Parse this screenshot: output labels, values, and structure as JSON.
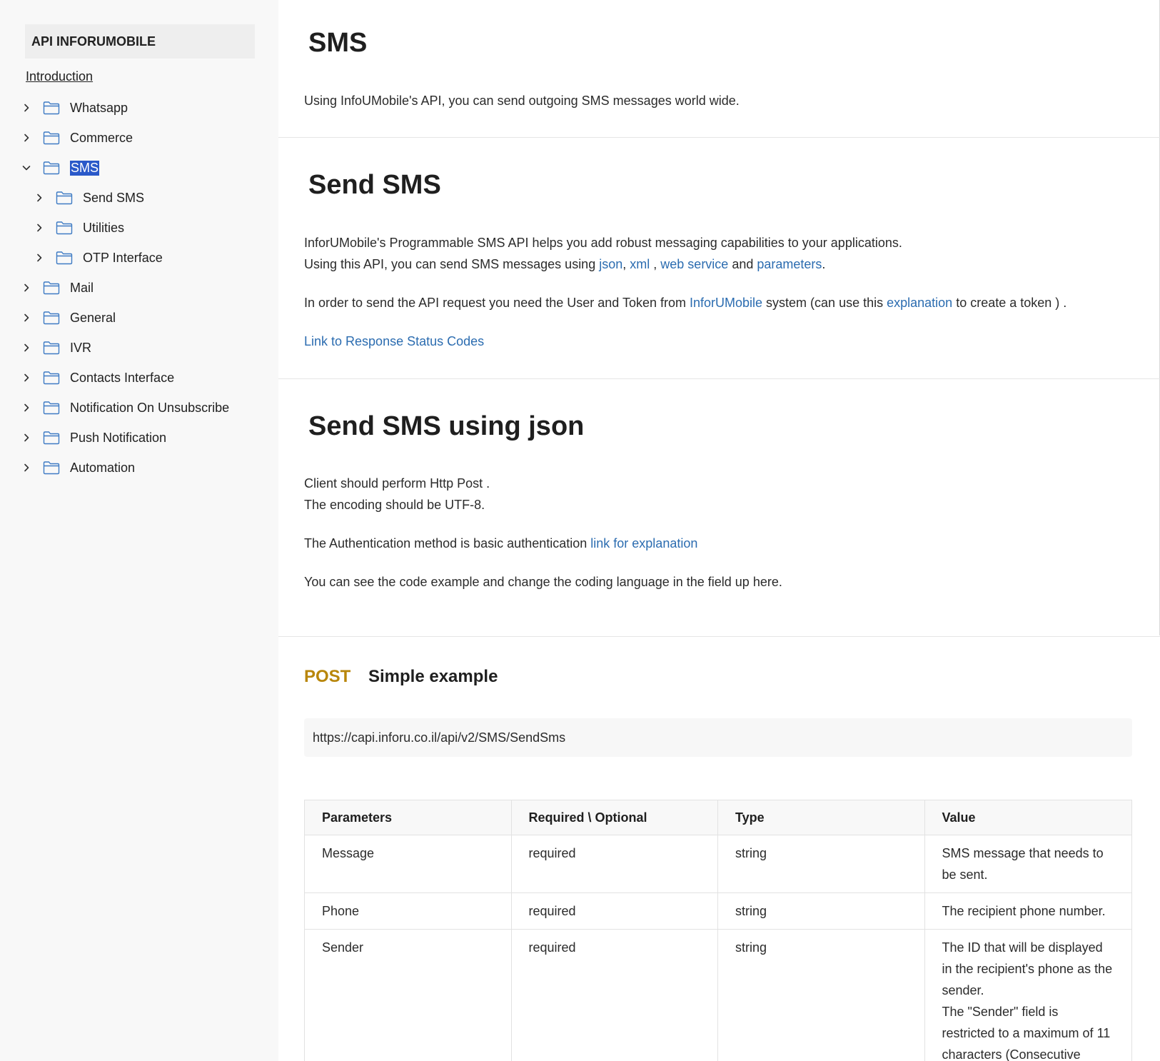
{
  "sidebar": {
    "brand": "API INFORUMOBILE",
    "intro": "Introduction",
    "items": [
      {
        "label": "Whatsapp",
        "level": 1,
        "expanded": false
      },
      {
        "label": "Commerce",
        "level": 1,
        "expanded": false
      },
      {
        "label": "SMS",
        "level": 1,
        "expanded": true,
        "selected": true
      },
      {
        "label": "Send SMS",
        "level": 2,
        "expanded": false
      },
      {
        "label": "Utilities",
        "level": 2,
        "expanded": false
      },
      {
        "label": "OTP Interface",
        "level": 2,
        "expanded": false
      },
      {
        "label": "Mail",
        "level": 1,
        "expanded": false
      },
      {
        "label": "General",
        "level": 1,
        "expanded": false
      },
      {
        "label": "IVR",
        "level": 1,
        "expanded": false
      },
      {
        "label": "Contacts Interface",
        "level": 1,
        "expanded": false
      },
      {
        "label": "Notification On Unsubscribe",
        "level": 1,
        "expanded": false
      },
      {
        "label": "Push Notification",
        "level": 1,
        "expanded": false
      },
      {
        "label": "Automation",
        "level": 1,
        "expanded": false
      }
    ]
  },
  "sms": {
    "title": "SMS",
    "desc": "Using InfoUMobile's API, you can send outgoing SMS messages world wide."
  },
  "send_sms": {
    "title": "Send SMS",
    "line1": "InforUMobile's Programmable SMS API helps you add robust messaging capabilities to your applications.",
    "line2_prefix": "Using this API, you can send SMS messages using ",
    "link_json": "json",
    "comma1": ", ",
    "link_xml": "xml",
    "comma2": " , ",
    "link_ws": "web service",
    "and": " and ",
    "link_params": "parameters",
    "dot": ".",
    "line3_prefix": "In order to send the API request you need the User and Token from ",
    "link_inforu": "InforUMobile",
    "line3_mid": " system (can use this ",
    "link_expl": "explanation",
    "line3_suffix": " to create a token ) .",
    "status_link": "Link to Response Status Codes"
  },
  "send_json": {
    "title": "Send SMS using json",
    "line1": "Client should perform Http Post .",
    "line2": "The encoding should be UTF-8.",
    "auth_prefix": "The Authentication method is basic authentication ",
    "auth_link": "link for explanation",
    "line4": "You can see the code example and change the coding language in the field up here."
  },
  "example": {
    "method": "POST",
    "title": "Simple example",
    "url": "https://capi.inforu.co.il/api/v2/SMS/SendSms"
  },
  "table": {
    "headers": [
      "Parameters",
      "Required \\ Optional",
      "Type",
      "Value"
    ],
    "rows": [
      [
        "Message",
        "required",
        "string",
        "SMS message that needs to be sent."
      ],
      [
        "Phone",
        "required",
        "string",
        "The recipient phone number."
      ],
      [
        "Sender",
        "required",
        "string",
        "The ID that will be displayed in the recipient's phone as the sender.\nThe \"Sender\" field is restricted to a maximum of 11 characters (Consecutive"
      ]
    ]
  },
  "colors": {
    "link": "#2b6cb0",
    "post": "#b8860b",
    "selected": "#2a59c9"
  }
}
